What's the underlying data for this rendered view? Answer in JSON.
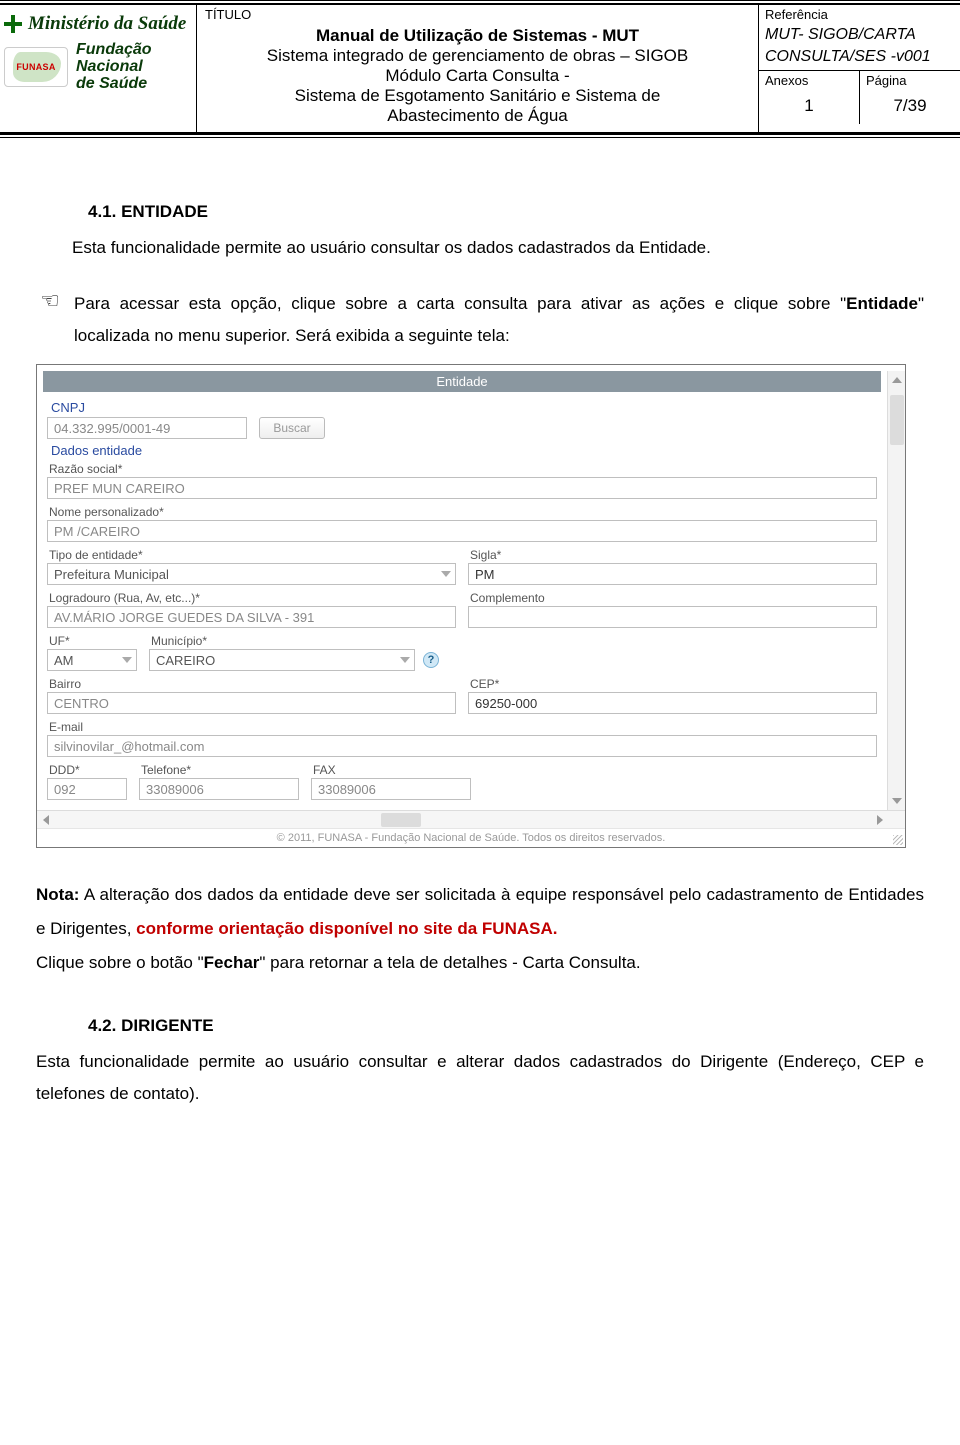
{
  "header": {
    "titulo_label": "TÍTULO",
    "ms_name": "Ministério da Saúde",
    "funasa_badge": "FUNASA",
    "fnds_l1": "Fundação",
    "fnds_l2": "Nacional",
    "fnds_l3": "de Saúde",
    "title_l1": "Manual de Utilização de Sistemas - MUT",
    "title_l2": "Sistema integrado de gerenciamento de obras – SIGOB",
    "title_l3": "Módulo Carta Consulta -",
    "title_l4": "Sistema de Esgotamento Sanitário e Sistema de",
    "title_l5": "Abastecimento de Água",
    "ref_label": "Referência",
    "ref_l1": "MUT- SIGOB/CARTA",
    "ref_l2": "CONSULTA/SES -v001",
    "anexos_label": "Anexos",
    "anexos_val": "1",
    "pagina_label": "Página",
    "pagina_val": "7/39"
  },
  "body": {
    "sec41_title": "4.1. ENTIDADE",
    "sec41_p1": "Esta funcionalidade permite ao usuário consultar os dados cadastrados da Entidade.",
    "tip41_a": "Para acessar esta opção, clique sobre a carta consulta para ativar as ações e clique sobre ",
    "tip41_bold": "Entidade",
    "tip41_b": " localizada no menu superior. Será exibida a seguinte tela:",
    "tip_icon": "☜",
    "note_bold": "Nota:",
    "note_txt1": " A alteração dos dados da entidade deve ser solicitada à equipe responsável pelo cadastramento de Entidades e Dirigentes, ",
    "note_red": "conforme orientação disponível no site da FUNASA.",
    "note_txt2_pre": "Clique sobre o botão ",
    "note_txt2_bold": "Fechar",
    "note_txt2_post": " para retornar a tela de detalhes - Carta Consulta.",
    "sec42_title": "4.2. DIRIGENTE",
    "sec42_p1": "Esta funcionalidade permite ao usuário consultar e alterar dados cadastrados do Dirigente (Endereço, CEP e telefones de contato)."
  },
  "screenshot": {
    "titlebar": "Entidade",
    "cnpj_fs": "CNPJ",
    "cnpj_val": "04.332.995/0001-49",
    "buscar": "Buscar",
    "dados_fs": "Dados entidade",
    "razao_lbl": "Razão social*",
    "razao_val": "PREF MUN CAREIRO",
    "nome_lbl": "Nome personalizado*",
    "nome_val": "PM /CAREIRO",
    "tipo_lbl": "Tipo de entidade*",
    "tipo_val": "Prefeitura Municipal",
    "sigla_lbl": "Sigla*",
    "sigla_val": "PM",
    "logr_lbl": "Logradouro (Rua, Av, etc...)*",
    "logr_val": "AV.MÁRIO JORGE GUEDES DA SILVA - 391",
    "compl_lbl": "Complemento",
    "compl_val": "",
    "uf_lbl": "UF*",
    "uf_val": "AM",
    "mun_lbl": "Município*",
    "mun_val": "CAREIRO",
    "help": "?",
    "bairro_lbl": "Bairro",
    "bairro_val": "CENTRO",
    "cep_lbl": "CEP*",
    "cep_val": "69250-000",
    "email_lbl": "E-mail",
    "email_val": "silvinovilar_@hotmail.com",
    "ddd_lbl": "DDD*",
    "ddd_val": "092",
    "tel_lbl": "Telefone*",
    "tel_val": "33089006",
    "fax_lbl": "FAX",
    "fax_val": "33089006",
    "footer": "© 2011, FUNASA - Fundação Nacional de Saúde. Todos os direitos reservados."
  }
}
